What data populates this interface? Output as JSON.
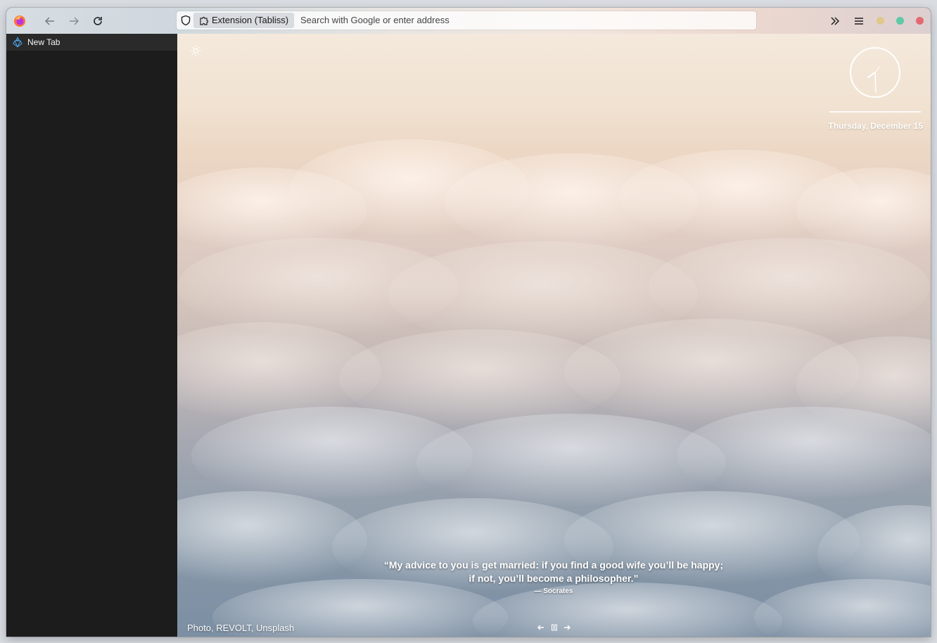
{
  "browser": {
    "url_chip_label": "Extension (Tabliss)",
    "url_placeholder": "Search with Google or enter address",
    "icons": [
      "firefox-icon",
      "back-icon",
      "forward-icon",
      "reload-icon",
      "shield-icon",
      "puzzle-icon",
      "overflow-chevrons-icon",
      "menu-icon"
    ],
    "window_dots": [
      "#e0c88a",
      "#5fc8a8",
      "#e46a72"
    ]
  },
  "sidebar": {
    "tabs": [
      {
        "label": "New Tab",
        "icon": "tabliss-icon"
      }
    ]
  },
  "newtab": {
    "date": "Thursday, December 15",
    "quote_line1": "“My advice to you is get married: if you find a good wife you’ll be happy;",
    "quote_line2": "if not, you’ll become a philosopher.”",
    "quote_author": "— Socrates",
    "photo_credit": "Photo, REVOLT, Unsplash"
  }
}
